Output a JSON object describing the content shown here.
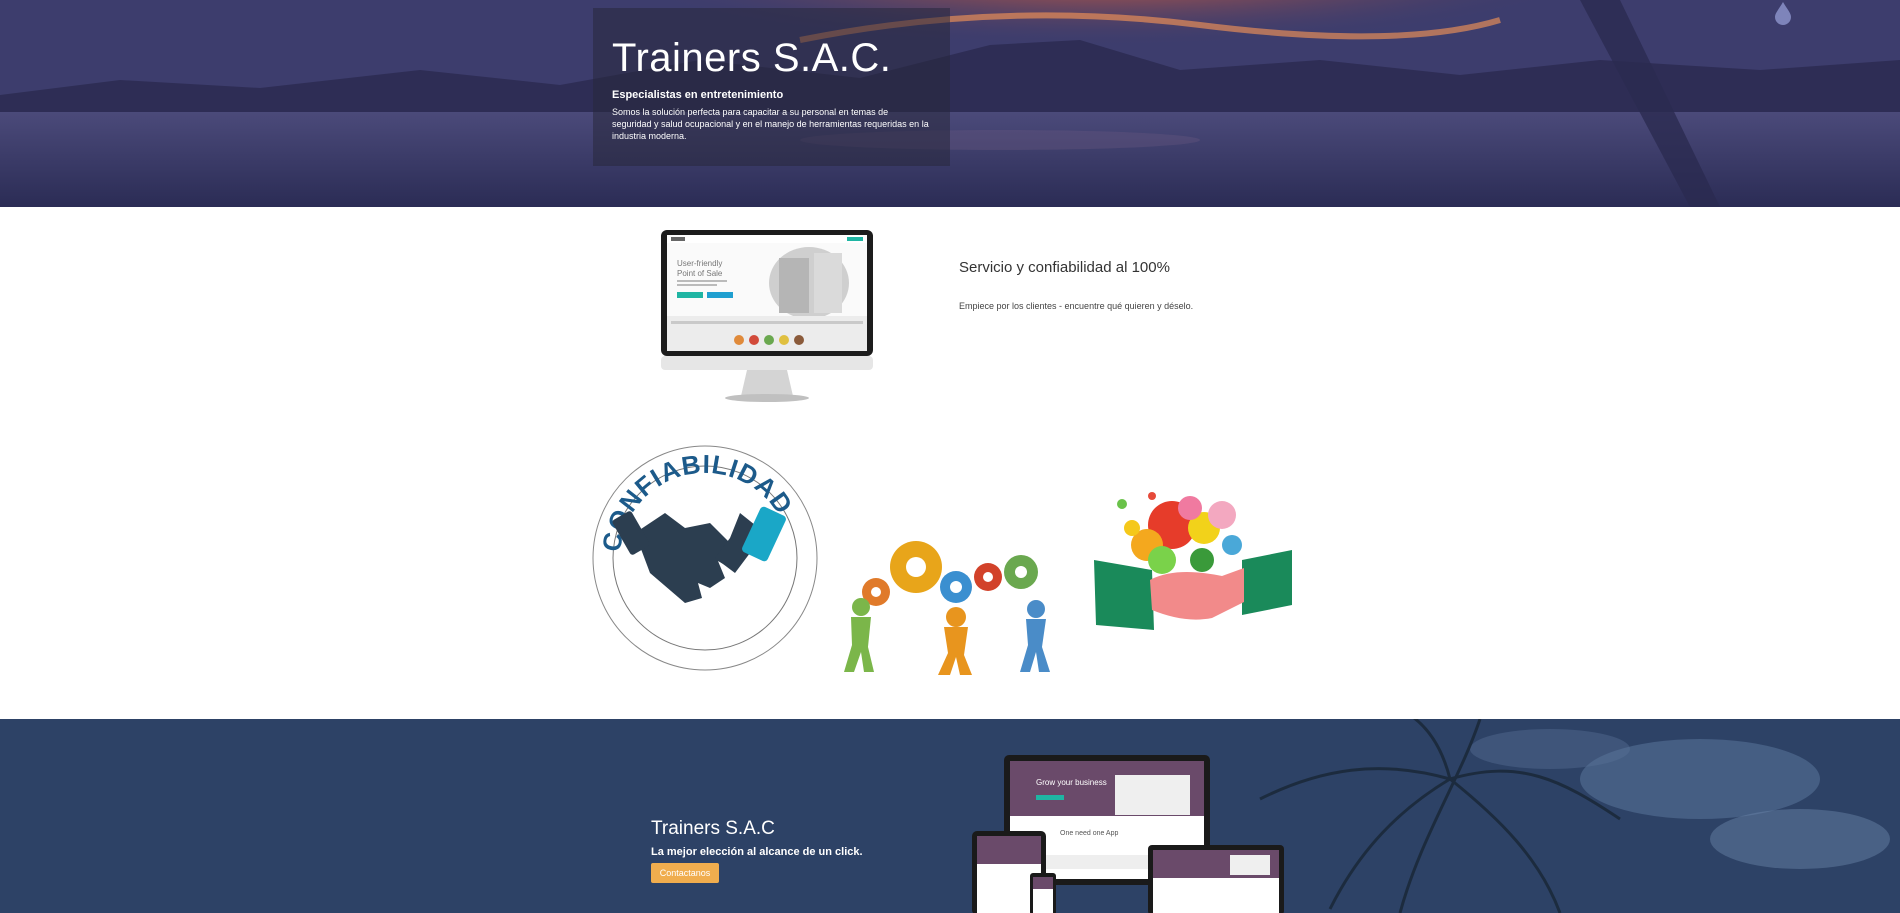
{
  "hero": {
    "title": "Trainers S.A.C.",
    "subtitle": "Especialistas en entretenimiento",
    "description": "Somos la solución perfecta para capacitar a su personal en temas de seguridad y salud ocupacional y en el manejo de herramientas requeridas en la industria moderna."
  },
  "feature": {
    "heading": "Servicio y confiabilidad al 100%",
    "text": "Empiece por los clientes - encuentre qué quieren y déselo.",
    "monitor_screen": {
      "heading_line1": "User-friendly",
      "heading_line2": "Point of Sale"
    }
  },
  "images": {
    "confiabilidad_text": "CONFIABILIDAD"
  },
  "cta": {
    "title": "Trainers S.A.C",
    "subtitle": "La mejor elección al alcance de un click.",
    "button_label": "Contactanos",
    "screen_text_1": "Grow your business",
    "screen_text_2": "One need one App"
  },
  "colors": {
    "accent_button": "#f0ad4e",
    "hero_overlay": "#28283c",
    "brand_teal": "#1fb5a3",
    "cta_bg": "#2e4468"
  },
  "icons": [
    "drop-icon",
    "monitor-image",
    "handshake-icon",
    "gears-icon",
    "handshake-colorful-icon"
  ]
}
